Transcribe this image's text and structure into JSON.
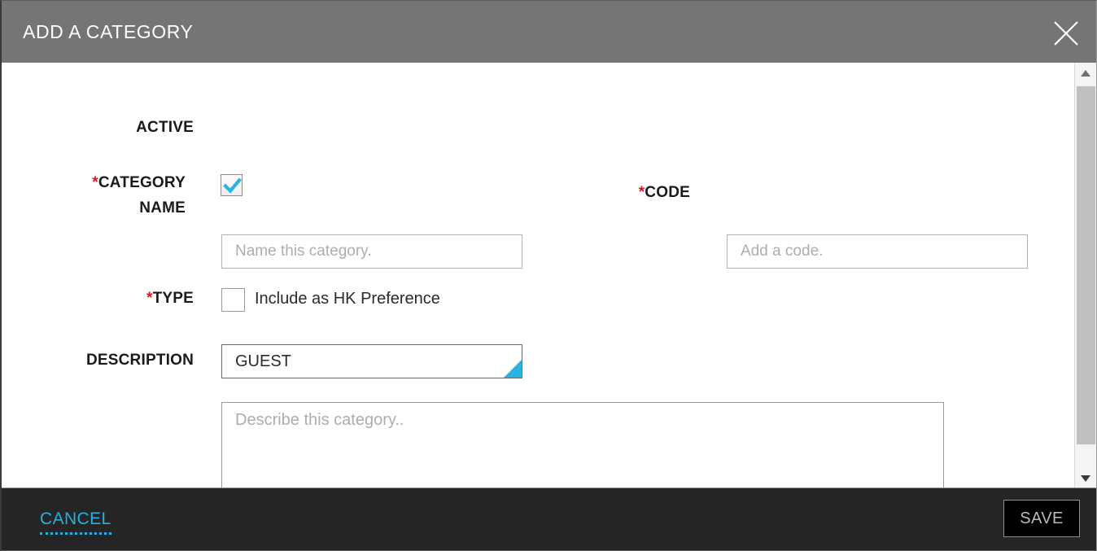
{
  "header": {
    "title": "ADD A CATEGORY",
    "close_icon": "close-x-icon"
  },
  "form": {
    "active": {
      "label": "ACTIVE",
      "checked": true,
      "check_color": "#2bb3e0"
    },
    "category_name": {
      "label_star": "*",
      "label": "CATEGORY NAME",
      "value": "",
      "placeholder": "Name this category."
    },
    "code": {
      "label_star": "*",
      "label": "CODE",
      "value": "",
      "placeholder": "Add a code."
    },
    "hk_preference": {
      "label": "Include as HK Preference",
      "checked": false
    },
    "type": {
      "label_star": "*",
      "label": "TYPE",
      "selected": "GUEST",
      "options": [
        "GUEST"
      ],
      "corner_color": "#2bb3e0"
    },
    "description": {
      "label": "DESCRIPTION",
      "value": "",
      "placeholder": "Describe this category..",
      "resize_grip_icon": "resize-grip-icon"
    }
  },
  "scrollbar": {
    "up_icon": "triangle-up-icon",
    "down_icon": "triangle-down-icon"
  },
  "footer": {
    "cancel_label": "CANCEL",
    "save_label": "SAVE",
    "accent_color": "#29b0dd"
  }
}
